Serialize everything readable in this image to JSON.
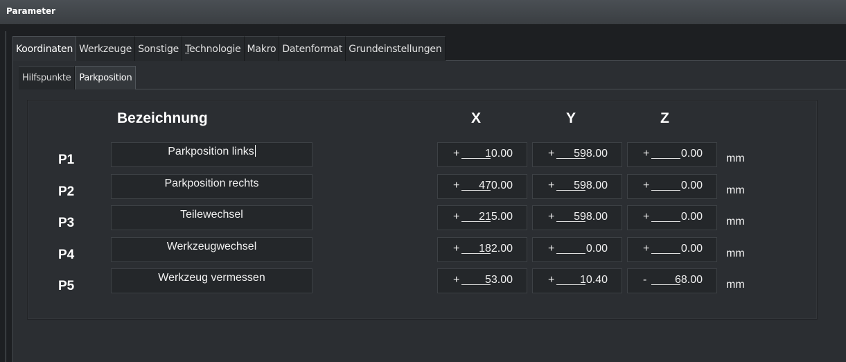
{
  "window": {
    "title": "Parameter"
  },
  "tabs": [
    {
      "label": "Koordinaten",
      "active": true
    },
    {
      "label": "Werkzeuge",
      "active": false
    },
    {
      "label": "Sonstige",
      "active": false
    },
    {
      "label": "Technologie",
      "active": false
    },
    {
      "label": "Makro",
      "active": false
    },
    {
      "label": "Datenformat",
      "active": false
    },
    {
      "label": "Grundeinstellungen",
      "active": false
    }
  ],
  "subtabs": [
    {
      "label": "Hilfspunkte",
      "active": false
    },
    {
      "label": "Parkposition",
      "active": true
    }
  ],
  "table": {
    "headers": {
      "name": "Bezeichnung",
      "x": "X",
      "y": "Y",
      "z": "Z"
    },
    "unit": "mm",
    "rows": [
      {
        "id": "P1",
        "name": "Parkposition links",
        "x": {
          "sign": "+",
          "value": "10.00"
        },
        "y": {
          "sign": "+",
          "value": "598.00"
        },
        "z": {
          "sign": "+",
          "value": "0.00"
        }
      },
      {
        "id": "P2",
        "name": "Parkposition rechts",
        "x": {
          "sign": "+",
          "value": "470.00"
        },
        "y": {
          "sign": "+",
          "value": "598.00"
        },
        "z": {
          "sign": "+",
          "value": "0.00"
        }
      },
      {
        "id": "P3",
        "name": "Teilewechsel",
        "x": {
          "sign": "+",
          "value": "215.00"
        },
        "y": {
          "sign": "+",
          "value": "598.00"
        },
        "z": {
          "sign": "+",
          "value": "0.00"
        }
      },
      {
        "id": "P4",
        "name": "Werkzeugwechsel",
        "x": {
          "sign": "+",
          "value": "182.00"
        },
        "y": {
          "sign": "+",
          "value": "0.00"
        },
        "z": {
          "sign": "+",
          "value": "0.00"
        }
      },
      {
        "id": "P5",
        "name": "Werkzeug vermessen",
        "x": {
          "sign": "+",
          "value": "53.00"
        },
        "y": {
          "sign": "+",
          "value": "10.40"
        },
        "z": {
          "sign": "-",
          "value": "68.00"
        }
      }
    ]
  }
}
